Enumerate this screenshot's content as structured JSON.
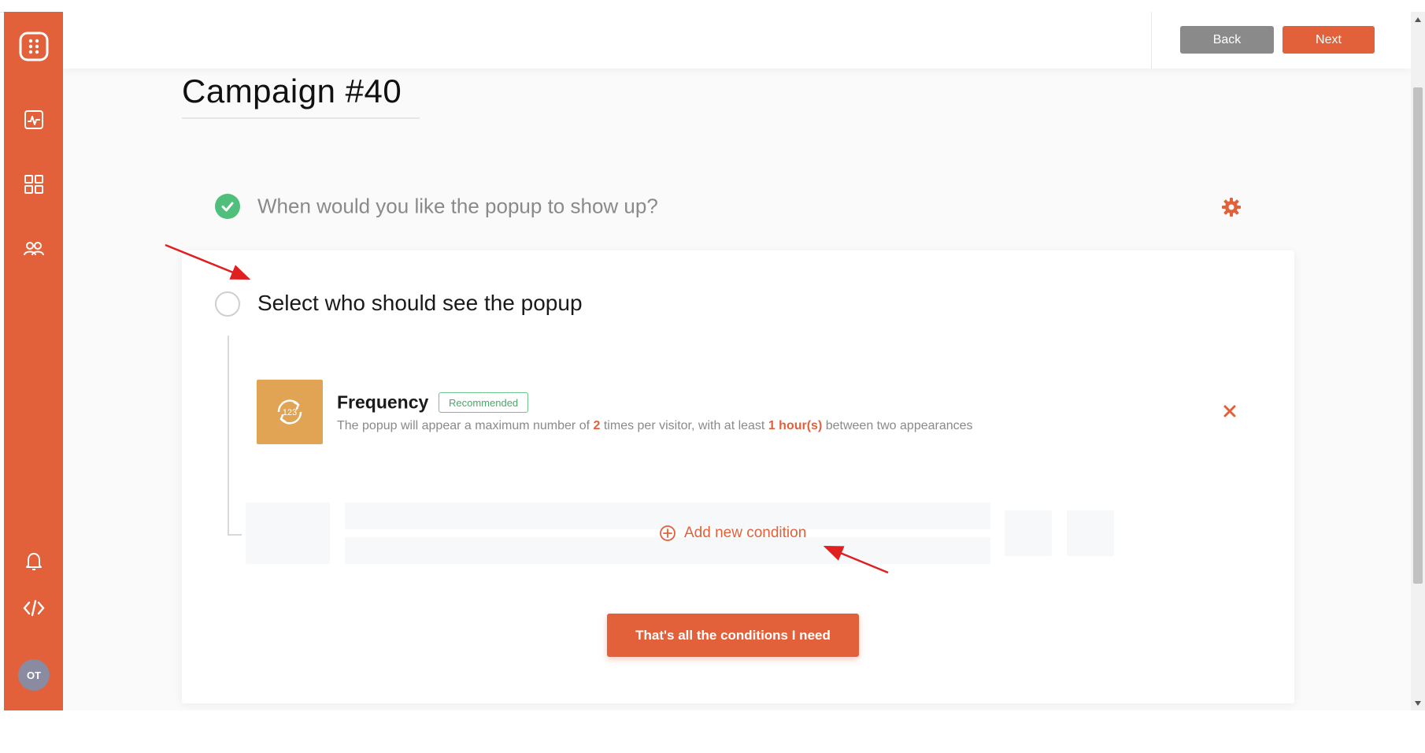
{
  "header": {
    "back_label": "Back",
    "next_label": "Next"
  },
  "campaign": {
    "title": "Campaign #40"
  },
  "sidebar": {
    "items": [
      {
        "icon": "logo-icon"
      },
      {
        "icon": "analytics-icon"
      },
      {
        "icon": "dashboard-grid-icon"
      },
      {
        "icon": "users-icon"
      },
      {
        "icon": "bell-icon"
      },
      {
        "icon": "code-icon"
      }
    ],
    "avatar_initials": "OT"
  },
  "steps": [
    {
      "title": "When would you like the popup to show up?",
      "status": "completed"
    },
    {
      "title": "Select who should see the popup",
      "status": "active"
    }
  ],
  "condition": {
    "title": "Frequency",
    "badge": "Recommended",
    "icon_text": "123",
    "desc_prefix": "The popup will appear a maximum number of",
    "count": "2",
    "desc_mid": "times per visitor, with at least",
    "interval": "1 hour(s)",
    "desc_suffix": "between two appearances"
  },
  "add_condition_label": "Add new condition",
  "done_label": "That's all the conditions I need",
  "colors": {
    "accent": "#e2603a",
    "success": "#4fbf7b",
    "frequency_tile": "#e1a454"
  }
}
